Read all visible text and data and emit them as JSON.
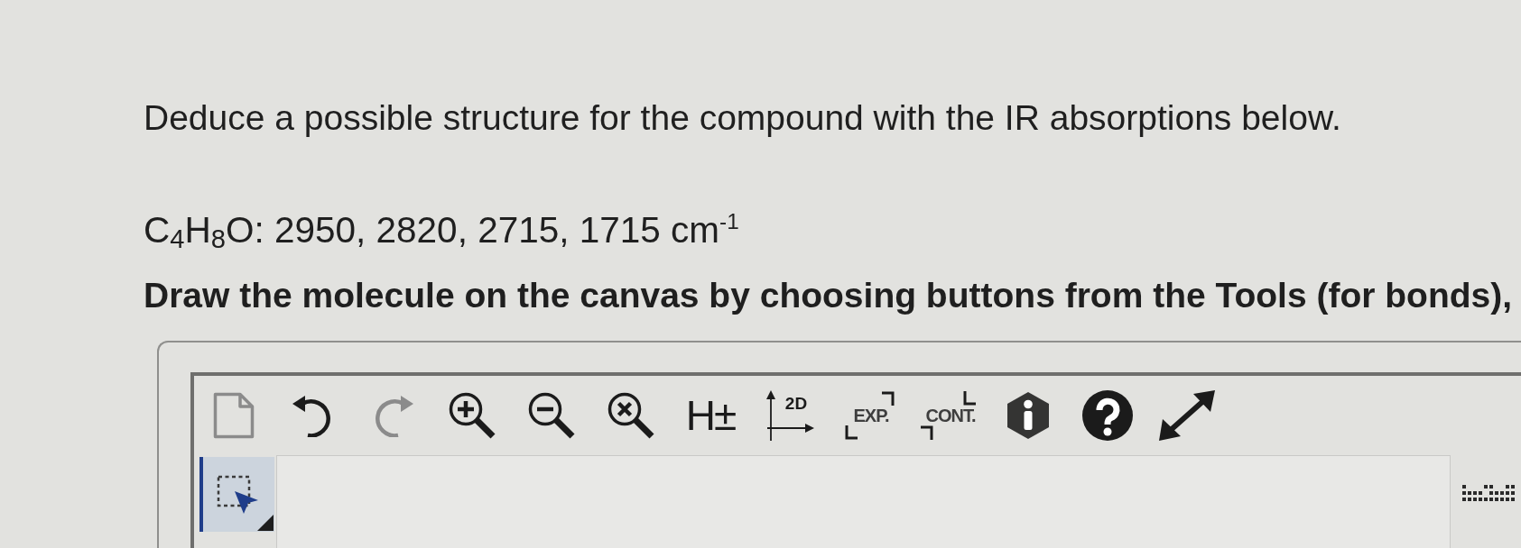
{
  "question": {
    "prompt": "Deduce a possible structure for the compound with the IR absorptions below.",
    "ir_data": "C$_{4}$H$_{8}$O: 2950, 2820, 2715, 1715 cm$^{-1}$",
    "instruction": "Draw the molecule on the canvas by choosing buttons from the Tools (for bonds),"
  },
  "editor": {
    "toolbar": [
      {
        "kind": "new",
        "disabled": true
      },
      {
        "kind": "undo",
        "disabled": false
      },
      {
        "kind": "redo",
        "disabled": true
      },
      {
        "kind": "zoomin",
        "disabled": false
      },
      {
        "kind": "zoomout",
        "disabled": false
      },
      {
        "kind": "zoomreset",
        "disabled": false
      },
      {
        "kind": "hydrogens",
        "label": "H±",
        "disabled": false
      },
      {
        "kind": "clean",
        "label": "2D",
        "disabled": false
      },
      {
        "kind": "expand",
        "label": "EXP.",
        "disabled": false
      },
      {
        "kind": "contract",
        "label": "CONT.",
        "disabled": false
      },
      {
        "kind": "info",
        "disabled": false
      },
      {
        "kind": "help",
        "disabled": false
      },
      {
        "kind": "fullscreen",
        "disabled": false
      }
    ],
    "tools": [
      {
        "kind": "select",
        "selected": true
      }
    ]
  }
}
